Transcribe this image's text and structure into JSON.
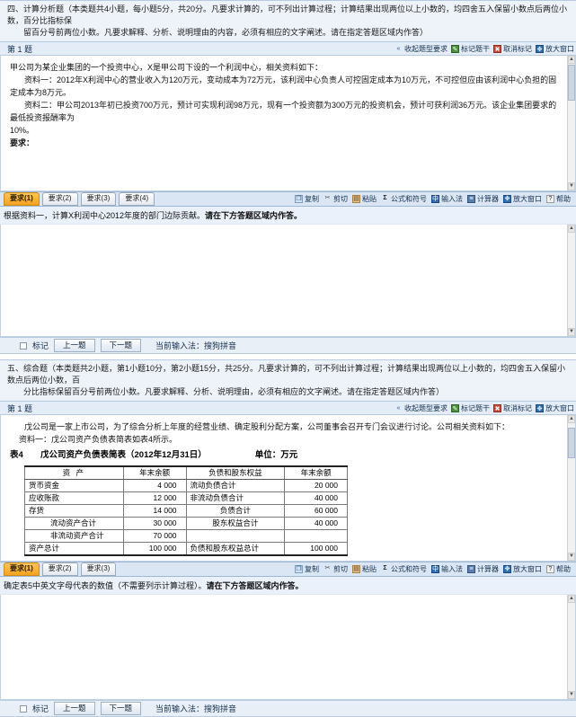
{
  "icons": {
    "collapse": "«",
    "mark": "✎",
    "unmark": "✖",
    "zoom": "✥",
    "copy": "❐",
    "cut": "✂",
    "paste": "▤",
    "sigma": "Σ",
    "ime": "中",
    "calc": "≡",
    "help": "?",
    "scroll_up": "▲",
    "scroll_down": "▼"
  },
  "toolbar_mini": {
    "collapse_label": "收起题型要求",
    "mark_label": "标记题干",
    "unmark_label": "取消标记",
    "zoom_label": "放大窗口"
  },
  "toolbar_edit": {
    "copy": "复制",
    "cut": "剪切",
    "paste": "粘贴",
    "formula": "公式和符号",
    "ime": "输入法",
    "calculator": "计算器",
    "zoom_window": "放大窗口",
    "help": "帮助"
  },
  "status_bar": {
    "mark_label": "标记",
    "prev_label": "上一题",
    "next_label": "下一题",
    "ime_label": "当前输入法：搜狗拼音"
  },
  "section_one": {
    "type_line1": "四、计算分析题（本类题共4小题，每小题5分，共20分。凡要求计算的，可不列出计算过程；计算结果出现两位以上小数的，均四舍五入保留小数点后两位小数，百分比指标保",
    "type_line2": "留百分号前两位小数。凡要求解释、分析、说明理由的内容，必须有相应的文字阐述。请在指定答题区域内作答）",
    "qnum": "第 1 题",
    "stem_p1": "甲公司为某企业集团的一个投资中心，X是甲公司下设的一个利润中心，相关资料如下：",
    "stem_p2": "资料一：2012年X利润中心的营业收入为120万元，变动成本为72万元，该利润中心负责人可控固定成本为10万元，不可控但应由该利润中心负担的固定成本为8万元。",
    "stem_p3": "资料二：甲公司2013年初已投资700万元，预计可实现利润98万元，现有一个投资额为300万元的投资机会，预计可获利润36万元。该企业集团要求的最低投资报酬率为",
    "stem_p4": "10%。",
    "stem_p5": "要求：",
    "tabs": [
      {
        "label": "要求(1)",
        "active": true
      },
      {
        "label": "要求(2)",
        "active": false
      },
      {
        "label": "要求(3)",
        "active": false
      },
      {
        "label": "要求(4)",
        "active": false
      }
    ],
    "req_text": "根据资料一，计算X利润中心2012年度的部门边际贡献。",
    "req_bold": "请在下方答题区域内作答。",
    "answer_value": ""
  },
  "section_two": {
    "type_line1": "五、综合题（本类题共2小题，第1小题10分，第2小题15分，共25分。凡要求计算的，可不列出计算过程；计算结果出现两位以上小数的，均四舍五入保留小数点后两位小数，百",
    "type_line2": "分比指标保留百分号前两位小数。凡要求解释、分析、说明理由，必须有相应的文字阐述。请在指定答题区域内作答）",
    "qnum": "第 1 题",
    "stem_p1": "戊公司是一家上市公司，为了综合分析上年度的经营业绩、确定股利分配方案，公司董事会召开专门会议进行讨论。公司相关资料如下：",
    "stem_p2": "资料一：戊公司资产负债表简表如表4所示。",
    "table": {
      "number": "表4",
      "name": "戊公司资产负债表简表（2012年12月31日）",
      "unit": "单位：万元",
      "headers": [
        "资 产",
        "年末余额",
        "负债和股东权益",
        "年末余额"
      ],
      "rows": [
        {
          "asset": "货币资金",
          "asset_indent": false,
          "asset_amount": "4 000",
          "liab": "流动负债合计",
          "liab_center": false,
          "liab_amount": "20 000"
        },
        {
          "asset": "应收账款",
          "asset_indent": false,
          "asset_amount": "12 000",
          "liab": "非流动负债合计",
          "liab_center": false,
          "liab_amount": "40 000"
        },
        {
          "asset": "存货",
          "asset_indent": false,
          "asset_amount": "14 000",
          "liab": "负债合计",
          "liab_center": true,
          "liab_amount": "60 000"
        },
        {
          "asset": "流动资产合计",
          "asset_indent": true,
          "asset_amount": "30 000",
          "liab": "股东权益合计",
          "liab_center": true,
          "liab_amount": "40 000"
        },
        {
          "asset": "非流动资产合计",
          "asset_indent": true,
          "asset_amount": "70 000",
          "liab": "",
          "liab_center": false,
          "liab_amount": ""
        },
        {
          "asset": "资产总计",
          "asset_indent": false,
          "asset_amount": "100 000",
          "liab": "负债和股东权益总计",
          "liab_center": false,
          "liab_amount": "100 000"
        }
      ]
    },
    "tabs": [
      {
        "label": "要求(1)",
        "active": true
      },
      {
        "label": "要求(2)",
        "active": false
      },
      {
        "label": "要求(3)",
        "active": false
      }
    ],
    "req_text": "确定表5中英文字母代表的数值（不需要列示计算过程）。",
    "req_bold": "请在下方答题区域内作答。",
    "answer_value": ""
  }
}
